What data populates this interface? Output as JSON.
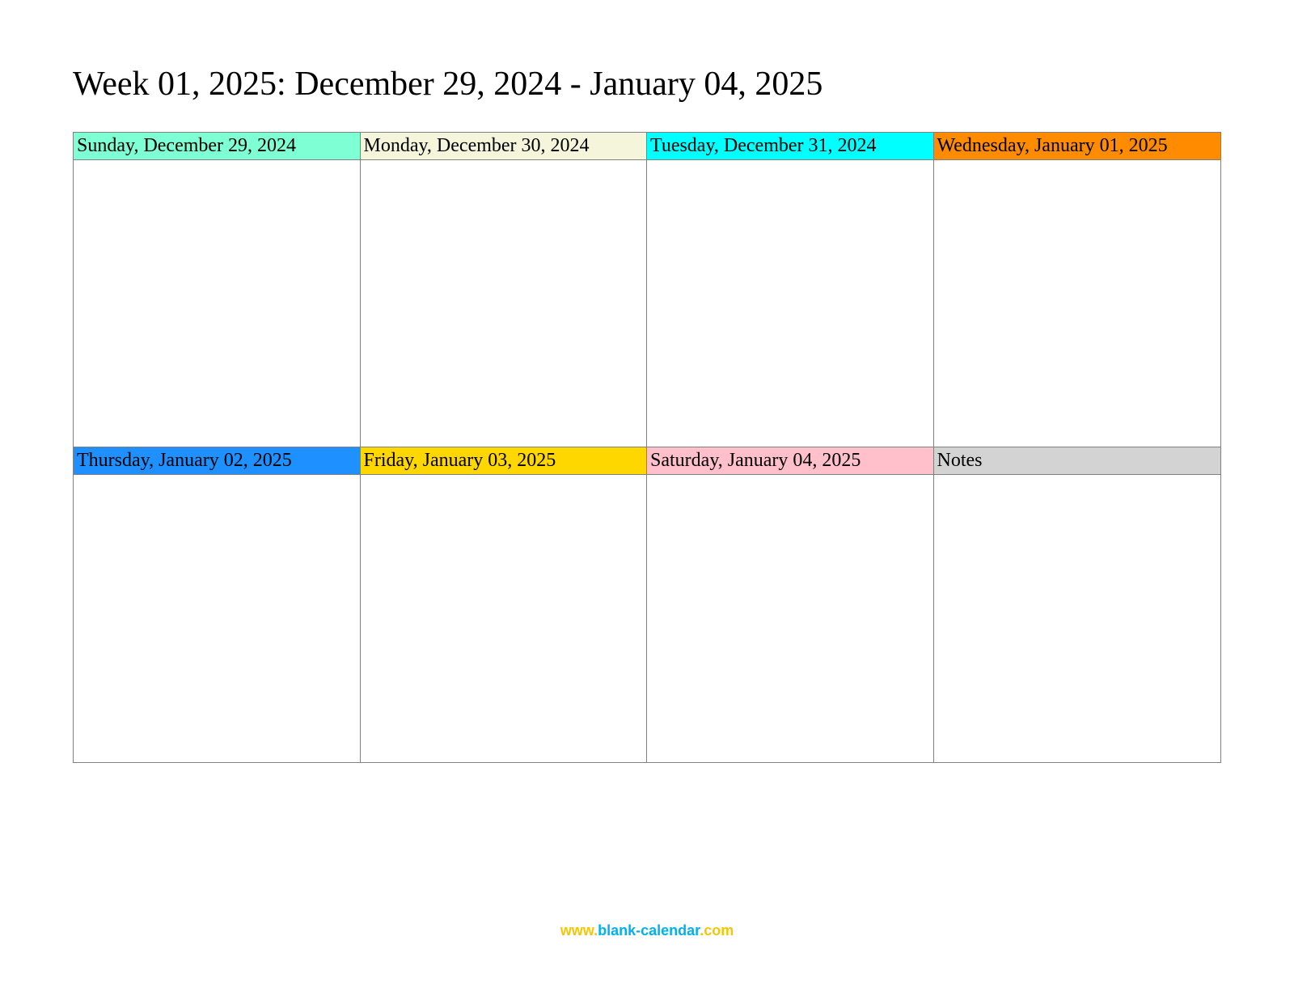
{
  "title": "Week 01, 2025: December 29, 2024 - January 04, 2025",
  "cells": [
    {
      "label": "Sunday, December 29, 2024",
      "color": "#7FFFD4"
    },
    {
      "label": "Monday, December 30, 2024",
      "color": "#F5F5DC"
    },
    {
      "label": "Tuesday, December 31, 2024",
      "color": "#00FFFF"
    },
    {
      "label": "Wednesday, January 01, 2025",
      "color": "#FF8C00"
    },
    {
      "label": "Thursday, January 02, 2025",
      "color": "#1E90FF"
    },
    {
      "label": "Friday, January 03, 2025",
      "color": "#FFD700"
    },
    {
      "label": "Saturday, January 04, 2025",
      "color": "#FFC0CB"
    },
    {
      "label": "Notes",
      "color": "#D3D3D3"
    }
  ],
  "footer": {
    "part1": "www.",
    "part2": "blank-calendar",
    "part3": ".com"
  }
}
